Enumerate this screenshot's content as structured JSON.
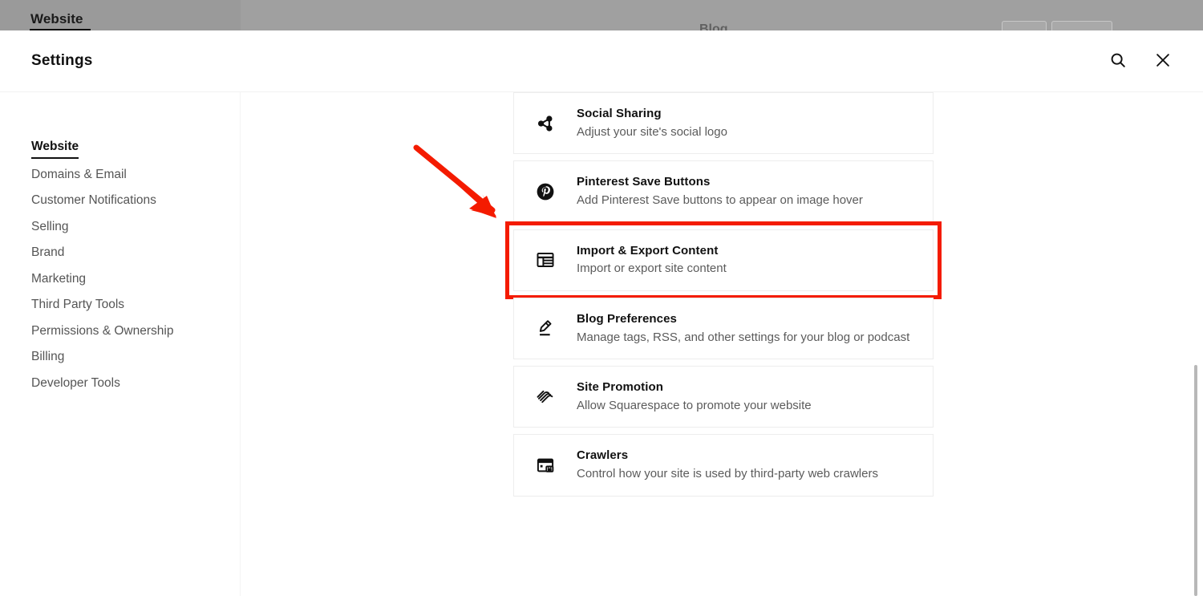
{
  "background": {
    "nav_tab_label": "Website",
    "center_label": "Blog",
    "bar_color": "#9a9a9a"
  },
  "header": {
    "title": "Settings",
    "search_icon": "search-icon",
    "close_icon": "close-icon"
  },
  "sidebar": {
    "items": [
      {
        "label": "Website",
        "active": true
      },
      {
        "label": "Domains & Email",
        "active": false
      },
      {
        "label": "Customer Notifications",
        "active": false
      },
      {
        "label": "Selling",
        "active": false
      },
      {
        "label": "Brand",
        "active": false
      },
      {
        "label": "Marketing",
        "active": false
      },
      {
        "label": "Third Party Tools",
        "active": false
      },
      {
        "label": "Permissions & Ownership",
        "active": false
      },
      {
        "label": "Billing",
        "active": false
      },
      {
        "label": "Developer Tools",
        "active": false
      }
    ]
  },
  "main": {
    "cards": [
      {
        "title": "Social Sharing",
        "desc": "Adjust your site's social logo",
        "icon": "social-share-icon",
        "highlighted": false
      },
      {
        "title": "Pinterest Save Buttons",
        "desc": "Add Pinterest Save buttons to appear on image hover",
        "icon": "pinterest-icon",
        "highlighted": false
      },
      {
        "title": "Import & Export Content",
        "desc": "Import or export site content",
        "icon": "table-grid-icon",
        "highlighted": true
      },
      {
        "title": "Blog Preferences",
        "desc": "Manage tags, RSS, and other settings for your blog or podcast",
        "icon": "blog-pen-icon",
        "highlighted": false
      },
      {
        "title": "Site Promotion",
        "desc": "Allow Squarespace to promote your website",
        "icon": "squarespace-icon",
        "highlighted": false
      },
      {
        "title": "Crawlers",
        "desc": "Control how your site is used by third-party web crawlers",
        "icon": "crawler-lock-icon",
        "highlighted": false
      }
    ]
  },
  "annotations": {
    "arrow_color": "#f41b00",
    "highlight_color": "#f41b00"
  }
}
